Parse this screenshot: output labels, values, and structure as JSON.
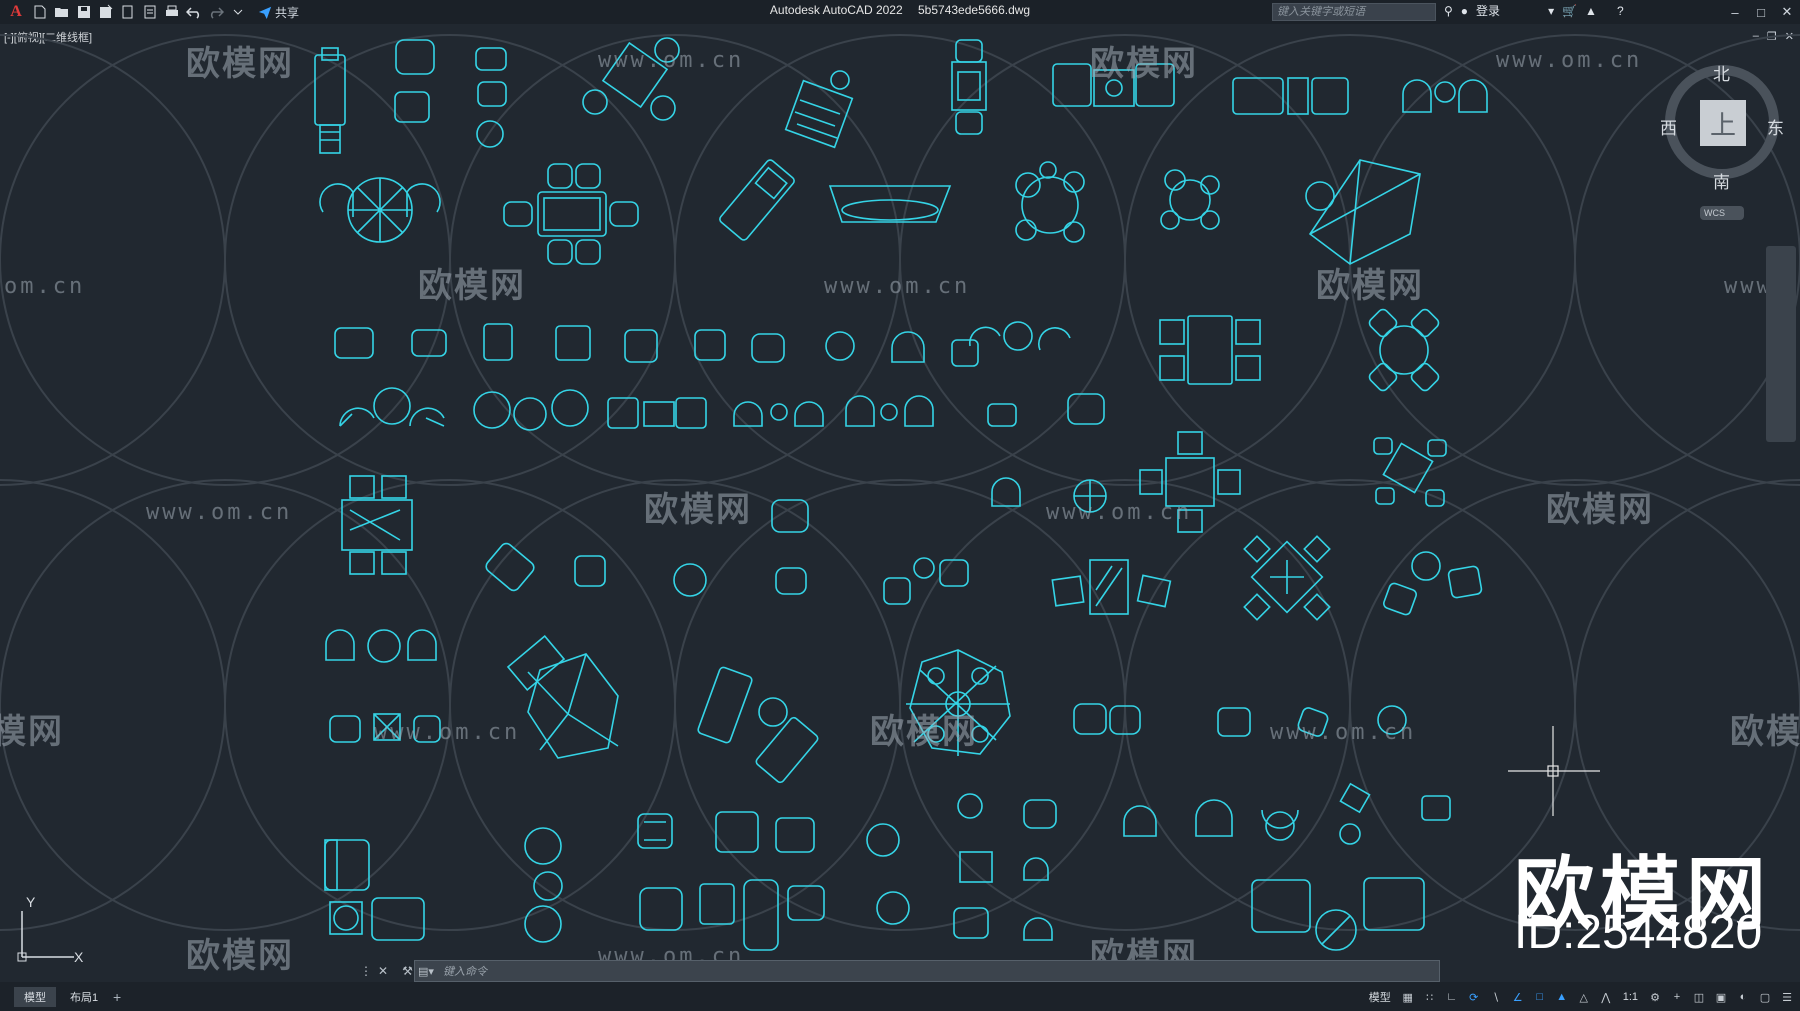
{
  "app": {
    "title": "Autodesk AutoCAD 2022",
    "filename": "5b5743ede5666.dwg",
    "share_label": "共享",
    "search_placeholder": "键入关键字或短语",
    "login_label": "登录"
  },
  "viewport": {
    "label": "[-][俯视][二维线框]"
  },
  "viewcube": {
    "north": "北",
    "south": "南",
    "west": "西",
    "east": "东",
    "face": "上",
    "wcs": "WCS"
  },
  "watermark": {
    "brand": "欧模网",
    "url": "www.om.cn",
    "url_partial_left": "om.cn",
    "url_partial_right": "www."
  },
  "overlay_logo": {
    "text": "欧模网",
    "id": "ID:2544820"
  },
  "ucs": {
    "x": "X",
    "y": "Y"
  },
  "command": {
    "placeholder": "键入命令"
  },
  "statusbar": {
    "tabs": [
      {
        "label": "模型",
        "active": true
      },
      {
        "label": "布局1",
        "active": false
      }
    ],
    "add_tab": "+",
    "model_label": "模型",
    "scale": "1:1"
  },
  "colors": {
    "background": "#212830",
    "cad_lines": "#35d4e6",
    "watermark": "#a0aab4"
  }
}
